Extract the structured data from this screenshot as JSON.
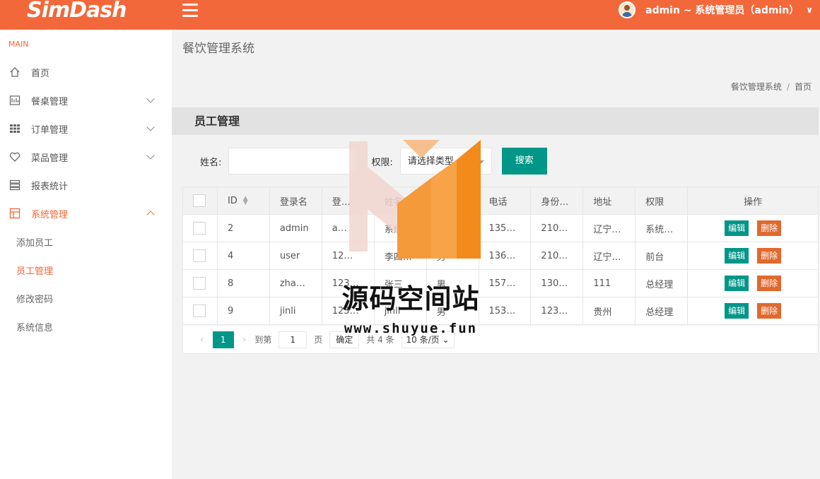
{
  "header": {
    "logo": "SimDash",
    "user_label": "admin ~ 系统管理员（admin）",
    "user_chevron": "∨"
  },
  "sidebar": {
    "section": "MAIN",
    "items": [
      {
        "label": "首页",
        "icon": "home-icon"
      },
      {
        "label": "餐桌管理",
        "icon": "table-icon"
      },
      {
        "label": "订单管理",
        "icon": "grid-icon"
      },
      {
        "label": "菜品管理",
        "icon": "heart-icon"
      },
      {
        "label": "报表统计",
        "icon": "report-icon"
      },
      {
        "label": "系统管理",
        "icon": "layout-icon"
      }
    ],
    "subitems": [
      {
        "label": "添加员工"
      },
      {
        "label": "员工管理"
      },
      {
        "label": "修改密码"
      },
      {
        "label": "系统信息"
      }
    ]
  },
  "page": {
    "title": "餐饮管理系统",
    "breadcrumb": [
      "餐饮管理系统",
      "首页"
    ],
    "breadcrumb_sep": "/"
  },
  "panel": {
    "title": "员工管理",
    "search": {
      "name_label": "姓名:",
      "name_value": "",
      "perm_label": "权限:",
      "perm_value": "请选择类型",
      "button": "搜索"
    },
    "table": {
      "columns": [
        "ID",
        "登录名",
        "登…",
        "姓名",
        "性别",
        "电话",
        "身份…",
        "地址",
        "权限",
        "操作"
      ],
      "rows": [
        {
          "id": "2",
          "login": "admin",
          "pwd": "a…",
          "name": "系统…",
          "sex": "",
          "phone": "135…",
          "idcard": "210…",
          "addr": "辽宁…",
          "perm": "系统…"
        },
        {
          "id": "4",
          "login": "user",
          "pwd": "12…",
          "name": "李四…",
          "sex": "男",
          "phone": "136…",
          "idcard": "210…",
          "addr": "辽宁…",
          "perm": "前台"
        },
        {
          "id": "8",
          "login": "zha…",
          "pwd": "123…",
          "name": "张三",
          "sex": "男",
          "phone": "157…",
          "idcard": "130…",
          "addr": "111",
          "perm": "总经理"
        },
        {
          "id": "9",
          "login": "jinli",
          "pwd": "123…",
          "name": "jinli",
          "sex": "男",
          "phone": "153…",
          "idcard": "123…",
          "addr": "贵州",
          "perm": "总经理"
        }
      ],
      "edit_label": "编辑",
      "delete_label": "删除"
    },
    "pager": {
      "prev": "‹",
      "current": "1",
      "next": "›",
      "goto_label": "到第",
      "goto_value": "1",
      "page_label": "页",
      "confirm": "确定",
      "total": "共 4 条",
      "per_page": "10 条/页"
    }
  },
  "watermark": {
    "title": "源码空间站",
    "url": "www.shuyue.fun"
  },
  "colors": {
    "accent": "#f2683a",
    "primary_btn": "#009688",
    "danger_btn": "#e2682d"
  }
}
